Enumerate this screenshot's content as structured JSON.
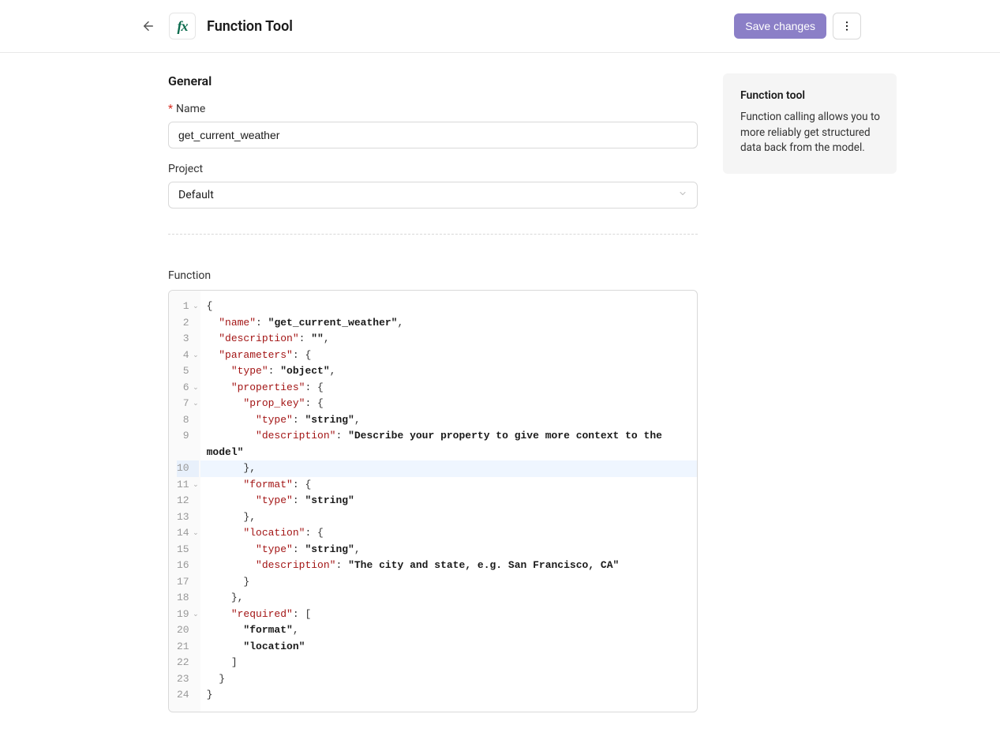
{
  "header": {
    "badge_text": "fx",
    "title": "Function Tool",
    "save_label": "Save changes"
  },
  "general": {
    "heading": "General",
    "name_label": "Name",
    "name_value": "get_current_weather",
    "project_label": "Project",
    "project_value": "Default"
  },
  "function_section": {
    "label": "Function",
    "highlighted_line": 10,
    "fold_lines": [
      1,
      4,
      6,
      7,
      11,
      14,
      19
    ],
    "lines": [
      [
        {
          "ind": 0
        },
        {
          "t": "punc",
          "v": "{"
        }
      ],
      [
        {
          "ind": 1
        },
        {
          "t": "key",
          "v": "\"name\""
        },
        {
          "t": "punc",
          "v": ": "
        },
        {
          "t": "str",
          "v": "\"get_current_weather\""
        },
        {
          "t": "punc",
          "v": ","
        }
      ],
      [
        {
          "ind": 1
        },
        {
          "t": "key",
          "v": "\"description\""
        },
        {
          "t": "punc",
          "v": ": "
        },
        {
          "t": "str",
          "v": "\"\""
        },
        {
          "t": "punc",
          "v": ","
        }
      ],
      [
        {
          "ind": 1
        },
        {
          "t": "key",
          "v": "\"parameters\""
        },
        {
          "t": "punc",
          "v": ": {"
        }
      ],
      [
        {
          "ind": 2
        },
        {
          "t": "key",
          "v": "\"type\""
        },
        {
          "t": "punc",
          "v": ": "
        },
        {
          "t": "str",
          "v": "\"object\""
        },
        {
          "t": "punc",
          "v": ","
        }
      ],
      [
        {
          "ind": 2
        },
        {
          "t": "key",
          "v": "\"properties\""
        },
        {
          "t": "punc",
          "v": ": {"
        }
      ],
      [
        {
          "ind": 3
        },
        {
          "t": "key",
          "v": "\"prop_key\""
        },
        {
          "t": "punc",
          "v": ": {"
        }
      ],
      [
        {
          "ind": 4
        },
        {
          "t": "key",
          "v": "\"type\""
        },
        {
          "t": "punc",
          "v": ": "
        },
        {
          "t": "str",
          "v": "\"string\""
        },
        {
          "t": "punc",
          "v": ","
        }
      ],
      [
        {
          "ind": 4,
          "tall": true
        },
        {
          "t": "key",
          "v": "\"description\""
        },
        {
          "t": "punc",
          "v": ": "
        },
        {
          "t": "str",
          "v": "\"Describe your property to give more context to the model\""
        }
      ],
      [
        {
          "ind": 3
        },
        {
          "t": "punc",
          "v": "},"
        }
      ],
      [
        {
          "ind": 3
        },
        {
          "t": "key",
          "v": "\"format\""
        },
        {
          "t": "punc",
          "v": ": {"
        }
      ],
      [
        {
          "ind": 4
        },
        {
          "t": "key",
          "v": "\"type\""
        },
        {
          "t": "punc",
          "v": ": "
        },
        {
          "t": "str",
          "v": "\"string\""
        }
      ],
      [
        {
          "ind": 3
        },
        {
          "t": "punc",
          "v": "},"
        }
      ],
      [
        {
          "ind": 3
        },
        {
          "t": "key",
          "v": "\"location\""
        },
        {
          "t": "punc",
          "v": ": {"
        }
      ],
      [
        {
          "ind": 4
        },
        {
          "t": "key",
          "v": "\"type\""
        },
        {
          "t": "punc",
          "v": ": "
        },
        {
          "t": "str",
          "v": "\"string\""
        },
        {
          "t": "punc",
          "v": ","
        }
      ],
      [
        {
          "ind": 4
        },
        {
          "t": "key",
          "v": "\"description\""
        },
        {
          "t": "punc",
          "v": ": "
        },
        {
          "t": "str",
          "v": "\"The city and state, e.g. San Francisco, CA\""
        }
      ],
      [
        {
          "ind": 3
        },
        {
          "t": "punc",
          "v": "}"
        }
      ],
      [
        {
          "ind": 2
        },
        {
          "t": "punc",
          "v": "},"
        }
      ],
      [
        {
          "ind": 2
        },
        {
          "t": "key",
          "v": "\"required\""
        },
        {
          "t": "punc",
          "v": ": ["
        }
      ],
      [
        {
          "ind": 3
        },
        {
          "t": "str",
          "v": "\"format\""
        },
        {
          "t": "punc",
          "v": ","
        }
      ],
      [
        {
          "ind": 3
        },
        {
          "t": "str",
          "v": "\"location\""
        }
      ],
      [
        {
          "ind": 2
        },
        {
          "t": "punc",
          "v": "]"
        }
      ],
      [
        {
          "ind": 1
        },
        {
          "t": "punc",
          "v": "}"
        }
      ],
      [
        {
          "ind": 0
        },
        {
          "t": "punc",
          "v": "}"
        }
      ]
    ]
  },
  "info": {
    "title": "Function tool",
    "body": "Function calling allows you to more reliably get structured data back from the model."
  }
}
